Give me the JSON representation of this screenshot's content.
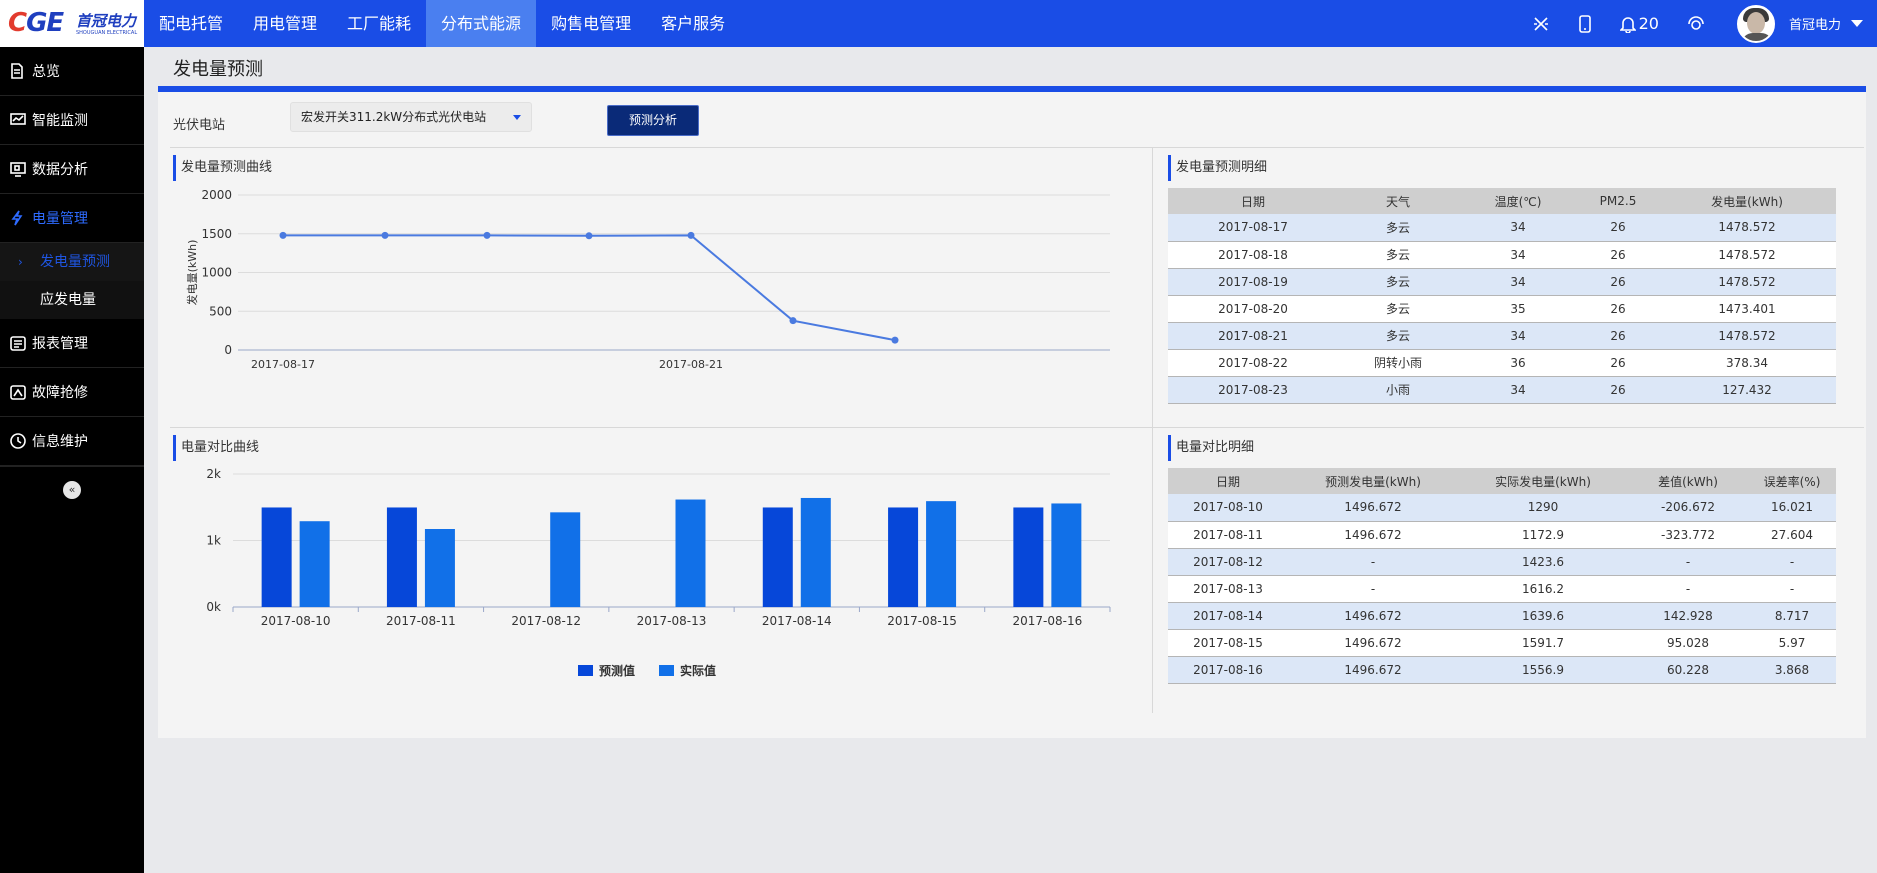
{
  "brand": {
    "logo_mark": "CGE",
    "logo_name": "首冠电力",
    "logo_sub": "SHOUGUAN ELECTRICAL"
  },
  "nav": [
    {
      "label": "配电托管",
      "active": false
    },
    {
      "label": "用电管理",
      "active": false
    },
    {
      "label": "工厂能耗",
      "active": false
    },
    {
      "label": "分布式能源",
      "active": true
    },
    {
      "label": "购售电管理",
      "active": false
    },
    {
      "label": "客户服务",
      "active": false
    }
  ],
  "header": {
    "notification_count": "20",
    "user_name": "首冠电力"
  },
  "sidebar": {
    "items": [
      {
        "label": "总览",
        "icon": "document-icon"
      },
      {
        "label": "智能监测",
        "icon": "monitor-icon"
      },
      {
        "label": "数据分析",
        "icon": "screen-icon"
      },
      {
        "label": "电量管理",
        "icon": "lightning-icon",
        "active": true
      },
      {
        "label": "报表管理",
        "icon": "report-icon"
      },
      {
        "label": "故障抢修",
        "icon": "repair-icon"
      },
      {
        "label": "信息维护",
        "icon": "clock-icon"
      }
    ],
    "subitems": [
      {
        "label": "发电量预测",
        "active": true
      },
      {
        "label": "应发电量",
        "active": false
      }
    ],
    "collapse_glyph": "«"
  },
  "page": {
    "title": "发电量预测"
  },
  "form": {
    "station_label": "光伏电站",
    "station_value": "宏发开关311.2kW分布式光伏电站",
    "predict_button": "预测分析"
  },
  "sections": {
    "forecast_curve": "发电量预测曲线",
    "forecast_detail": "发电量预测明细",
    "compare_curve": "电量对比曲线",
    "compare_detail": "电量对比明细"
  },
  "colors": {
    "primary": "#1a4de6",
    "forecast_bar": "#0647d9",
    "actual_bar": "#1170e8",
    "line": "#4a7ae0"
  },
  "forecast_table": {
    "headers": [
      "日期",
      "天气",
      "温度(℃)",
      "PM2.5",
      "发电量(kWh)"
    ],
    "rows": [
      [
        "2017-08-17",
        "多云",
        "34",
        "26",
        "1478.572"
      ],
      [
        "2017-08-18",
        "多云",
        "34",
        "26",
        "1478.572"
      ],
      [
        "2017-08-19",
        "多云",
        "34",
        "26",
        "1478.572"
      ],
      [
        "2017-08-20",
        "多云",
        "35",
        "26",
        "1473.401"
      ],
      [
        "2017-08-21",
        "多云",
        "34",
        "26",
        "1478.572"
      ],
      [
        "2017-08-22",
        "阴转小雨",
        "36",
        "26",
        "378.34"
      ],
      [
        "2017-08-23",
        "小雨",
        "34",
        "26",
        "127.432"
      ]
    ]
  },
  "compare_table": {
    "headers": [
      "日期",
      "预测发电量(kWh)",
      "实际发电量(kWh)",
      "差值(kWh)",
      "误差率(%)"
    ],
    "rows": [
      [
        "2017-08-10",
        "1496.672",
        "1290",
        "-206.672",
        "16.021"
      ],
      [
        "2017-08-11",
        "1496.672",
        "1172.9",
        "-323.772",
        "27.604"
      ],
      [
        "2017-08-12",
        "-",
        "1423.6",
        "-",
        "-"
      ],
      [
        "2017-08-13",
        "-",
        "1616.2",
        "-",
        "-"
      ],
      [
        "2017-08-14",
        "1496.672",
        "1639.6",
        "142.928",
        "8.717"
      ],
      [
        "2017-08-15",
        "1496.672",
        "1591.7",
        "95.028",
        "5.97"
      ],
      [
        "2017-08-16",
        "1496.672",
        "1556.9",
        "60.228",
        "3.868"
      ]
    ]
  },
  "chart_data": [
    {
      "type": "line",
      "x": [
        "2017-08-17",
        "2017-08-18",
        "2017-08-19",
        "2017-08-20",
        "2017-08-21",
        "2017-08-22",
        "2017-08-23"
      ],
      "xticks": [
        "2017-08-17",
        "2017-08-21"
      ],
      "series": [
        {
          "values": [
            1478.572,
            1478.572,
            1478.572,
            1473.401,
            1478.572,
            378.34,
            127.432
          ]
        }
      ],
      "ylabel": "发电量(kWh)",
      "ylim": [
        0,
        2000
      ],
      "yticks": [
        "0",
        "500",
        "1000",
        "1500",
        "2000"
      ],
      "grid": true
    },
    {
      "type": "bar",
      "categories": [
        "2017-08-10",
        "2017-08-11",
        "2017-08-12",
        "2017-08-13",
        "2017-08-14",
        "2017-08-15",
        "2017-08-16"
      ],
      "series": [
        {
          "name": "预测值",
          "values": [
            1496.672,
            1496.672,
            null,
            null,
            1496.672,
            1496.672,
            1496.672
          ]
        },
        {
          "name": "实际值",
          "values": [
            1290,
            1172.9,
            1423.6,
            1616.2,
            1639.6,
            1591.7,
            1556.9
          ]
        }
      ],
      "ylim": [
        0,
        2000
      ],
      "yticks": [
        "0k",
        "1k",
        "2k"
      ],
      "legend": "bottom",
      "grid": true
    }
  ]
}
